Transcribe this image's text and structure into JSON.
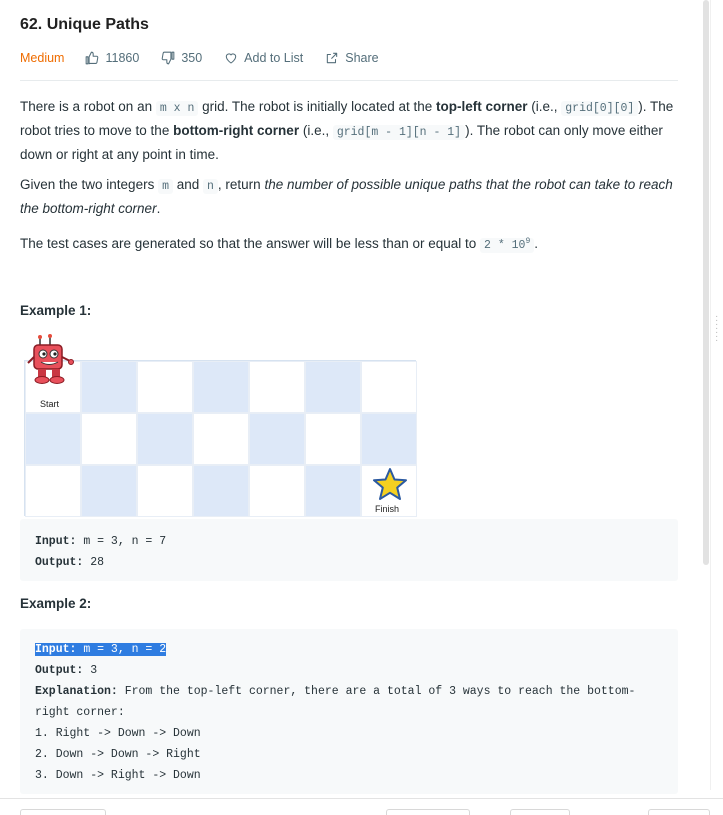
{
  "problem": {
    "title": "62. Unique Paths",
    "difficulty": "Medium",
    "likes": "11860",
    "dislikes": "350",
    "add_to_list": "Add to List",
    "share": "Share"
  },
  "description": {
    "p1_a": "There is a robot on an ",
    "p1_code1": "m x n",
    "p1_b": " grid. The robot is initially located at the ",
    "p1_bold1": "top-left corner",
    "p1_c": " (i.e., ",
    "p1_code2": "grid[0][0]",
    "p1_d": "). The robot tries to move to the ",
    "p1_bold2": "bottom-right corner",
    "p1_e": " (i.e., ",
    "p1_code3": "grid[m - 1][n - 1]",
    "p1_f": "). The robot can only move either down or right at any point in time.",
    "p2_a": "Given the two integers ",
    "p2_code1": "m",
    "p2_b": " and ",
    "p2_code2": "n",
    "p2_c": ", return ",
    "p2_italic": "the number of possible unique paths that the robot can take to reach the bottom-right corner",
    "p2_d": ".",
    "p3_a": "The test cases are generated so that the answer will be less than or equal to ",
    "p3_code": "2 * 10",
    "p3_sup": "9",
    "p3_b": "."
  },
  "example1": {
    "heading": "Example 1:",
    "start_label": "Start",
    "finish_label": "Finish",
    "input_label": "Input:",
    "input_value": " m = 3, n = 7",
    "output_label": "Output:",
    "output_value": " 28",
    "grid_pattern": [
      [
        "white",
        "blue",
        "white",
        "blue",
        "white",
        "blue",
        "white"
      ],
      [
        "blue",
        "white",
        "blue",
        "white",
        "blue",
        "white",
        "blue"
      ],
      [
        "white",
        "blue",
        "white",
        "blue",
        "white",
        "blue",
        "white"
      ]
    ]
  },
  "example2": {
    "heading": "Example 2:",
    "input_label": "Input:",
    "input_value": " m = 3, n = 2",
    "output_label": "Output:",
    "output_value": " 3",
    "explanation_label": "Explanation:",
    "explanation_value": " From the top-left corner, there are a total of 3 ways to reach the bottom-",
    "explanation_cont": "right corner:",
    "paths": [
      "1. Right -> Down -> Down",
      "2. Down -> Down -> Right",
      "3. Down -> Right -> Down"
    ]
  },
  "colors": {
    "difficulty": "#ef6c00",
    "grid_blue": "#dde8f8",
    "selection": "#2f7de1"
  }
}
